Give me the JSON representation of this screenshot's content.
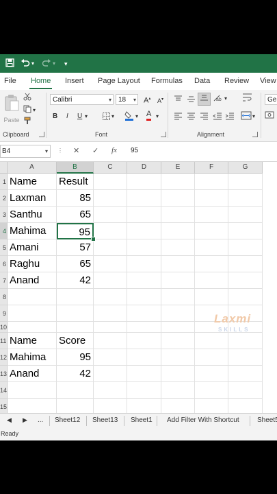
{
  "quick_access": {
    "save_icon": "save-icon",
    "undo_icon": "undo-icon",
    "redo_icon": "redo-icon",
    "customize": "▾"
  },
  "ribbon_tabs": [
    "File",
    "Home",
    "Insert",
    "Page Layout",
    "Formulas",
    "Data",
    "Review",
    "View"
  ],
  "active_tab": "Home",
  "ribbon": {
    "paste_label": "Paste",
    "clipboard_label": "Clipboard",
    "font_label": "Font",
    "alignment_label": "Alignment",
    "font_name": "Calibri",
    "font_size": "18",
    "bold": "B",
    "italic": "I",
    "underline": "U",
    "grow_font": "A",
    "shrink_font": "A",
    "font_color": "A",
    "number_format_partial": "Ge"
  },
  "formula_bar": {
    "name_box": "B4",
    "cancel": "✕",
    "enter": "✓",
    "function": "fx",
    "value": "95"
  },
  "columns": [
    "A",
    "B",
    "C",
    "D",
    "E",
    "F",
    "G"
  ],
  "rows": [
    "1",
    "2",
    "3",
    "4",
    "5",
    "6",
    "7",
    "8",
    "9",
    "10",
    "11",
    "12",
    "13",
    "14",
    "15"
  ],
  "cells": {
    "A1": "Name",
    "B1": "Result",
    "A2": "Laxman",
    "B2": "85",
    "A3": "Santhu",
    "B3": "65",
    "A4": "Mahima",
    "B4": "95",
    "A5": "Amani",
    "B5": "57",
    "A6": "Raghu",
    "B6": "65",
    "A7": "Anand",
    "B7": "42",
    "A11": "Name",
    "B11": "Score",
    "A12": "Mahima",
    "B12": "95",
    "A13": "Anand",
    "B13": "42"
  },
  "active_cell": "B4",
  "watermark": {
    "top": "Laxmi",
    "bottom": "SKILLS"
  },
  "sheet_tabs": [
    "...",
    "Sheet12",
    "Sheet13",
    "Sheet1",
    "Add Filter With Shortcut",
    "Sheet5"
  ],
  "status": "Ready",
  "colors": {
    "excel_green": "#217346",
    "ribbon_bg": "#f3f3f3"
  }
}
